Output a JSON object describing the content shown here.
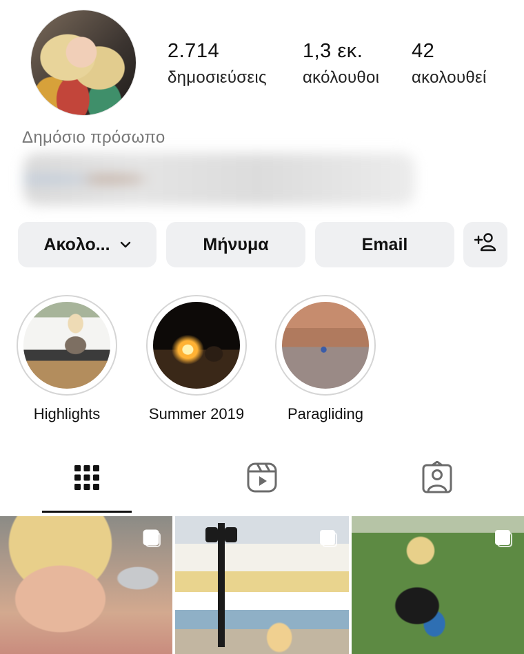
{
  "profile": {
    "category": "Δημόσιο πρόσωπο",
    "stats": [
      {
        "value": "2.714",
        "label": "δημοσιεύσεις"
      },
      {
        "value": "1,3 εκ.",
        "label": "ακόλουθοι"
      },
      {
        "value": "42",
        "label": "ακολουθεί"
      }
    ]
  },
  "actions": {
    "follow_label": "Ακολο...",
    "message_label": "Μήνυμα",
    "email_label": "Email"
  },
  "highlights": [
    {
      "label": "Highlights"
    },
    {
      "label": "Summer 2019"
    },
    {
      "label": "Paragliding"
    }
  ],
  "tabs": {
    "active": "grid-icon"
  },
  "colors": {
    "button_bg": "#eff0f2",
    "text": "#111111",
    "muted": "#777777"
  }
}
